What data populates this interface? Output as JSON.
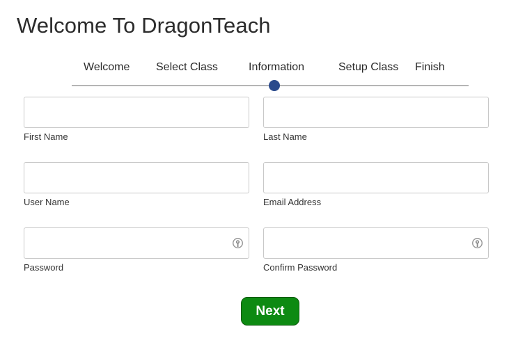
{
  "page_title": "Welcome To DragonTeach",
  "steps": [
    {
      "label": "Welcome"
    },
    {
      "label": "Select Class"
    },
    {
      "label": "Information"
    },
    {
      "label": "Setup Class"
    },
    {
      "label": "Finish"
    }
  ],
  "progress": {
    "current_step": 3,
    "total_steps": 5,
    "indicator_color": "#2a4a8c"
  },
  "form": {
    "first_name": {
      "label": "First Name",
      "value": "",
      "placeholder": ""
    },
    "last_name": {
      "label": "Last Name",
      "value": "",
      "placeholder": ""
    },
    "user_name": {
      "label": "User Name",
      "value": "",
      "placeholder": ""
    },
    "email": {
      "label": "Email Address",
      "value": "",
      "placeholder": ""
    },
    "password": {
      "label": "Password",
      "value": "",
      "placeholder": "",
      "icon": "key-icon"
    },
    "confirm_password": {
      "label": "Confirm Password",
      "value": "",
      "placeholder": "",
      "icon": "key-icon"
    }
  },
  "next_button": {
    "label": "Next",
    "color": "#0d8a12"
  }
}
